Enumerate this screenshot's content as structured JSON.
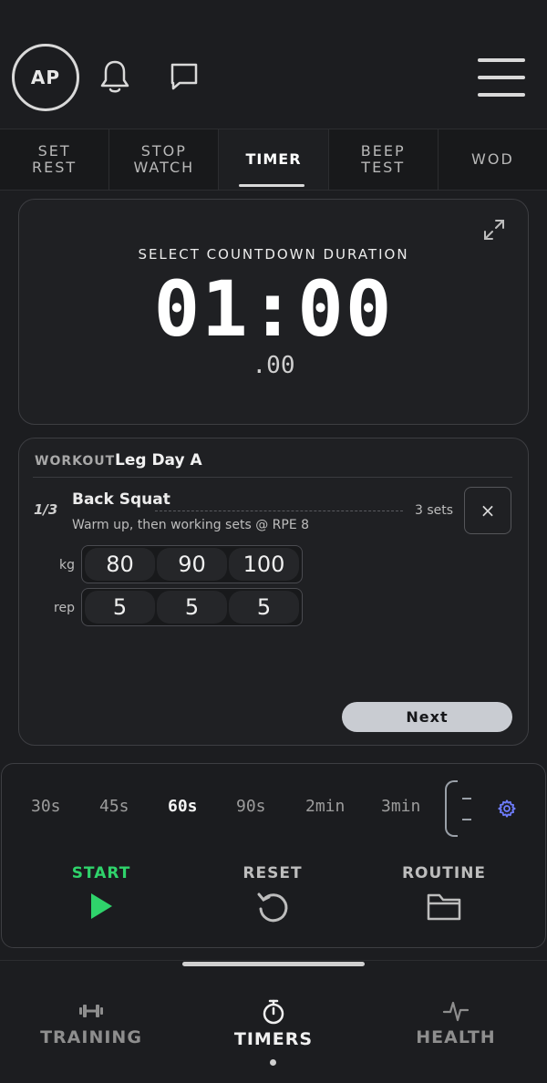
{
  "header": {
    "avatar_initials": "AP",
    "icons": [
      "bell-icon",
      "chat-icon",
      "hamburger-menu-icon"
    ]
  },
  "tabs": [
    {
      "label": "SET\nREST",
      "active": false
    },
    {
      "label": "STOP\nWATCH",
      "active": false
    },
    {
      "label": "TIMER",
      "active": true
    },
    {
      "label": "BEEP\nTEST",
      "active": false
    },
    {
      "label": "WOD",
      "active": false
    }
  ],
  "timer": {
    "prompt": "SELECT COUNTDOWN DURATION",
    "time": "01:00",
    "fraction": ".00"
  },
  "workout": {
    "label": "WORKOUT",
    "name": "Leg Day A",
    "counter": "1/3",
    "exercise": "Back Squat",
    "sets": "3 sets",
    "note": "Warm up, then working sets @ RPE 8",
    "close_label": "×",
    "rows": [
      {
        "label": "kg",
        "values": [
          "80",
          "90",
          "100"
        ]
      },
      {
        "label": "rep",
        "values": [
          "5",
          "5",
          "5"
        ]
      }
    ],
    "next_label": "Next"
  },
  "presets": [
    {
      "label": "30s",
      "active": false
    },
    {
      "label": "45s",
      "active": false
    },
    {
      "label": "60s",
      "active": true
    },
    {
      "label": "90s",
      "active": false
    },
    {
      "label": "2min",
      "active": false
    },
    {
      "label": "3min",
      "active": false
    }
  ],
  "controls": {
    "start": "START",
    "reset": "RESET",
    "routine": "ROUTINE",
    "start_color": "#2fd36b"
  },
  "bottom_nav": [
    {
      "label": "TRAINING",
      "icon": "dumbbell-icon",
      "active": false
    },
    {
      "label": "TIMERS",
      "icon": "stopwatch-icon",
      "active": true
    },
    {
      "label": "HEALTH",
      "icon": "pulse-icon",
      "active": false
    }
  ]
}
